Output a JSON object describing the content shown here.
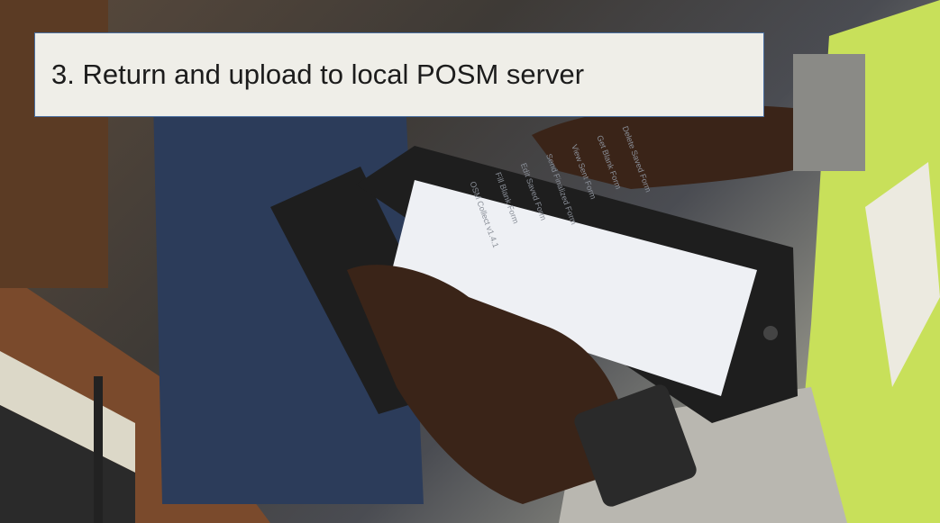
{
  "caption": {
    "text": "3. Return and upload to local POSM server"
  },
  "tablet": {
    "menu_items": [
      "OSM Collect v1.4.1",
      "Fill Blank Form",
      "Edit Saved Form",
      "Send Finalized Form",
      "View Sent Form",
      "Get Blank Form",
      "Delete Saved Form"
    ]
  },
  "colors": {
    "caption_background": "#efeee8",
    "caption_border": "#4a6fa0",
    "vest": "#c8e05a",
    "tablet_case": "#1e1e1e",
    "tablet_screen": "#eef0f4"
  },
  "icons": [
    "photograph",
    "tablet",
    "watch",
    "router-antenna"
  ]
}
